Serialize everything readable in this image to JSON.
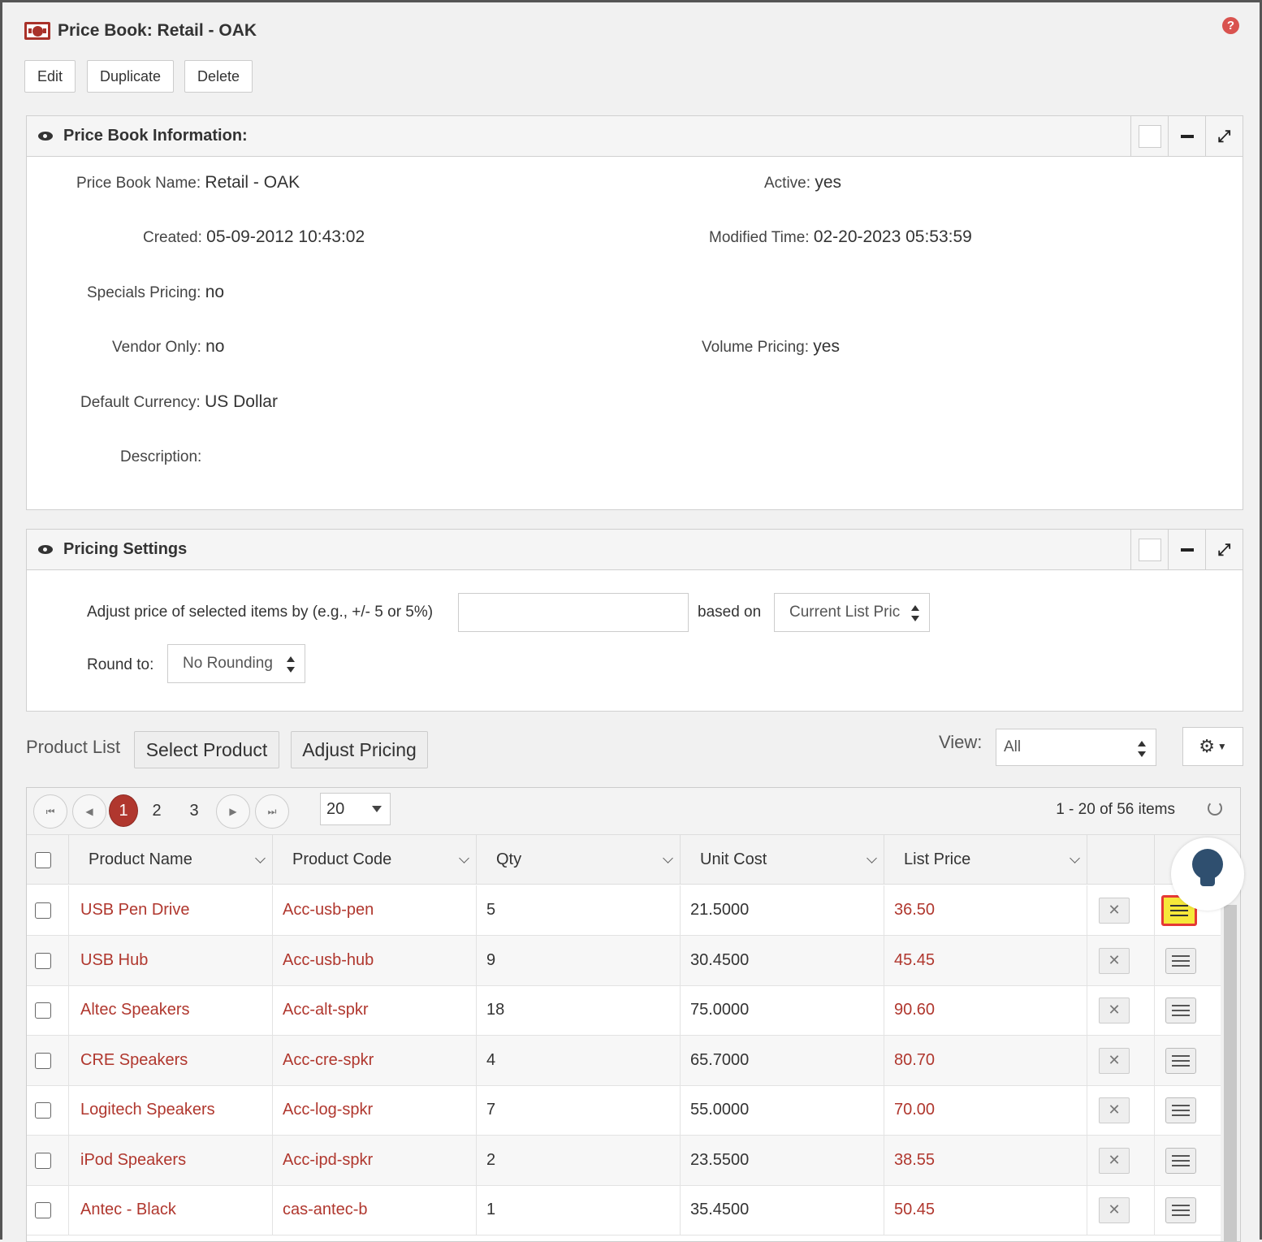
{
  "header": {
    "title": "Price Book: Retail - OAK",
    "icon": "price-book-icon",
    "help_icon": "?"
  },
  "actions": {
    "edit": "Edit",
    "duplicate": "Duplicate",
    "delete": "Delete"
  },
  "info_panel": {
    "title": "Price Book Information:",
    "fields": {
      "name_label": "Price Book Name:",
      "name_value": "Retail - OAK",
      "active_label": "Active:",
      "active_value": "yes",
      "created_label": "Created:",
      "created_value": "05-09-2012 10:43:02",
      "modified_label": "Modified Time:",
      "modified_value": "02-20-2023 05:53:59",
      "specials_label": "Specials Pricing:",
      "specials_value": "no",
      "vendor_label": "Vendor Only:",
      "vendor_value": "no",
      "volume_label": "Volume Pricing:",
      "volume_value": "yes",
      "currency_label": "Default Currency:",
      "currency_value": "US Dollar",
      "description_label": "Description:",
      "description_value": ""
    }
  },
  "pricing_panel": {
    "title": "Pricing Settings",
    "adjust_label": "Adjust price of selected items by (e.g., +/- 5 or 5%)",
    "adjust_value": "",
    "based_on_label": "based on",
    "based_on_value": "Current List Pric",
    "round_label": "Round to:",
    "round_value": "No Rounding"
  },
  "product_list": {
    "label": "Product List",
    "select_product": "Select Product",
    "adjust_pricing": "Adjust Pricing",
    "view_label": "View:",
    "view_value": "All",
    "pager": {
      "pages": [
        "1",
        "2",
        "3"
      ],
      "active_page": "1",
      "page_size": "20",
      "info": "1 - 20 of 56 items"
    },
    "columns": [
      "Product Name",
      "Product Code",
      "Qty",
      "Unit Cost",
      "List Price"
    ],
    "rows": [
      {
        "name": "USB Pen Drive",
        "code": "Acc-usb-pen",
        "qty": "5",
        "unit_cost": "21.5000",
        "list_price": "36.50"
      },
      {
        "name": "USB Hub",
        "code": "Acc-usb-hub",
        "qty": "9",
        "unit_cost": "30.4500",
        "list_price": "45.45"
      },
      {
        "name": "Altec Speakers",
        "code": "Acc-alt-spkr",
        "qty": "18",
        "unit_cost": "75.0000",
        "list_price": "90.60"
      },
      {
        "name": "CRE Speakers",
        "code": "Acc-cre-spkr",
        "qty": "4",
        "unit_cost": "65.7000",
        "list_price": "80.70"
      },
      {
        "name": "Logitech Speakers",
        "code": "Acc-log-spkr",
        "qty": "7",
        "unit_cost": "55.0000",
        "list_price": "70.00"
      },
      {
        "name": "iPod Speakers",
        "code": "Acc-ipd-spkr",
        "qty": "2",
        "unit_cost": "23.5500",
        "list_price": "38.55"
      },
      {
        "name": "Antec - Black",
        "code": "cas-antec-b",
        "qty": "1",
        "unit_cost": "35.4500",
        "list_price": "50.45"
      }
    ]
  },
  "colors": {
    "accent": "#b0372e",
    "highlight": "#f6e83a",
    "highlight_border": "#e53935"
  }
}
